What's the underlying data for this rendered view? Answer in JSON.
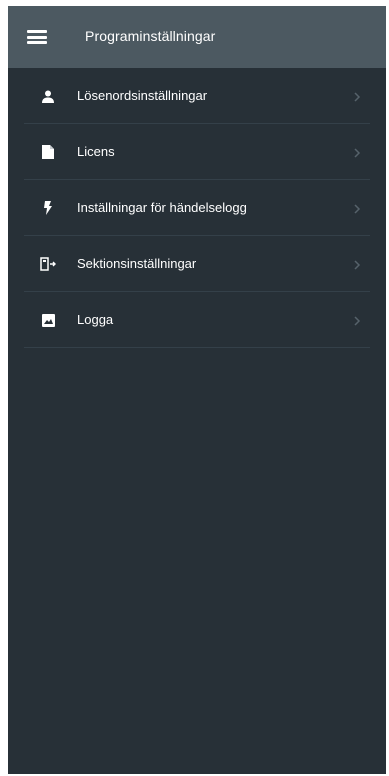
{
  "app_bar": {
    "title": "Programinställningar",
    "menu_icon": "hamburger-menu-icon"
  },
  "settings": {
    "items": [
      {
        "label": "Lösenordsinställningar",
        "icon": "person-icon"
      },
      {
        "label": "Licens",
        "icon": "document-icon"
      },
      {
        "label": "Inställningar för händelselogg",
        "icon": "lightning-bolt-icon"
      },
      {
        "label": "Sektionsinställningar",
        "icon": "exit-door-icon"
      },
      {
        "label": "Logga",
        "icon": "image-icon"
      }
    ]
  },
  "colors": {
    "background": "#273037",
    "app_bar": "#4c5961",
    "divider": "#344049",
    "text": "#ffffff",
    "chevron": "#56626b"
  }
}
